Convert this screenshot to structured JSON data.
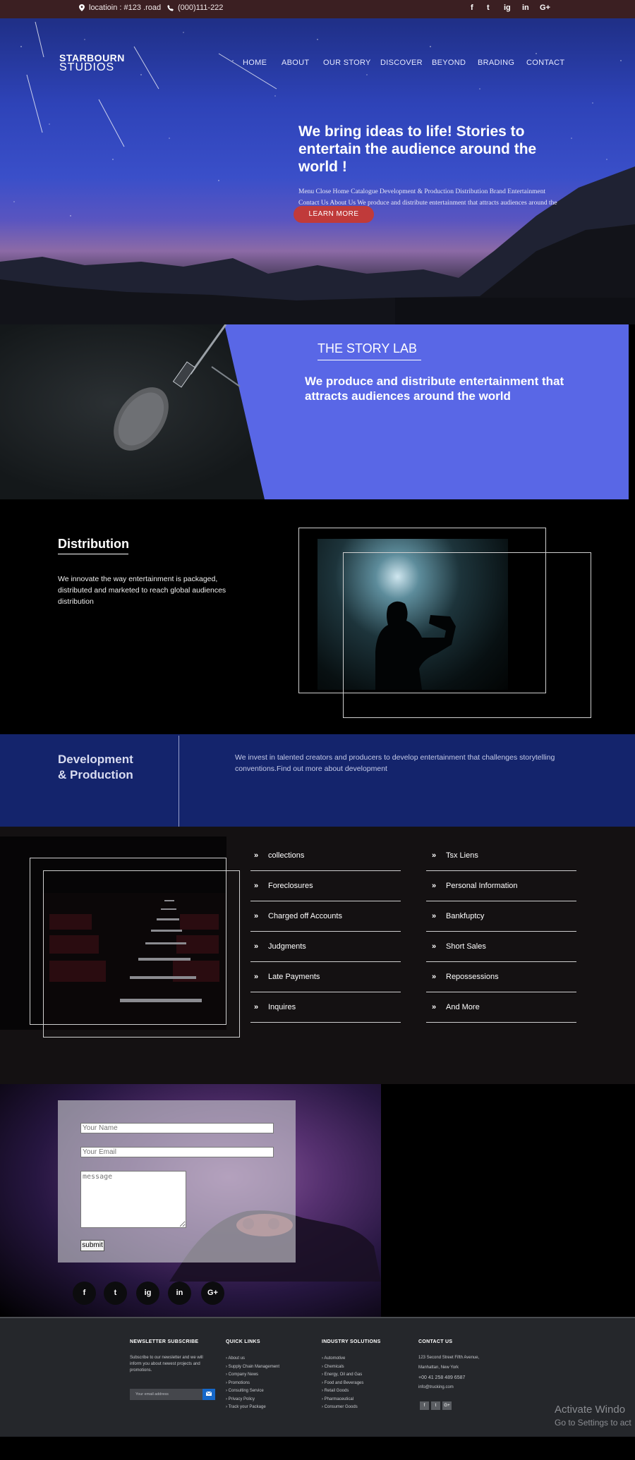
{
  "topbar": {
    "location": "locatioin : #123 .road",
    "phone": "(000)111-222",
    "social": [
      "f",
      "t",
      "ig",
      "in",
      "G+"
    ]
  },
  "brand": {
    "line1": "STARBOURN",
    "line2": "STUDIOS"
  },
  "nav": [
    "HOME",
    "ABOUT",
    "OUR STORY",
    "DISCOVER",
    "BEYOND",
    "BRADING",
    "CONTACT"
  ],
  "hero": {
    "headline": "We bring ideas to life! Stories to entertain the audience around the world !",
    "subtext": "Menu Close Home Catalogue Development & Production Distribution Brand Entertainment Contact Us About Us We produce and distribute entertainment that attracts audiences around the world",
    "cta": "LEARN MORE"
  },
  "story_lab": {
    "title": "THE STORY LAB",
    "text": "We produce and distribute entertainment that attracts audiences around the world"
  },
  "distribution": {
    "title": "Distribution",
    "text": "We innovate the way entertainment is packaged, distributed and marketed to reach global audiences distribution"
  },
  "development": {
    "title_line1": "Development",
    "title_line2": "& Production",
    "text": "We invest in talented creators and producers to develop entertainment that challenges storytelling conventions.Find out more about development"
  },
  "services": {
    "left": [
      "collections",
      "Foreclosures",
      "Charged off Accounts",
      "Judgments",
      "Late Payments",
      "Inquires"
    ],
    "right": [
      "Tsx Liens",
      "Personal Information",
      "Bankfuptcy",
      "Short Sales",
      "Repossessions",
      "And More"
    ]
  },
  "contact_form": {
    "name_placeholder": "Your Name",
    "email_placeholder": "Your Email",
    "message_placeholder": "message",
    "submit": "submit"
  },
  "contact_social": [
    "f",
    "t",
    "ig",
    "in",
    "G+"
  ],
  "footer": {
    "newsletter": {
      "title": "NEWSLETTER SUBSCRIBE",
      "text": "Subscribe to our newsletter and we will inform you about newest projects and promotions.",
      "input_placeholder": "Your email address"
    },
    "quick_links": {
      "title": "QUICK LINKS",
      "items": [
        "About us",
        "Supply Chain Management",
        "Company News",
        "Promotions",
        "Consulting Service",
        "Privacy Policy",
        "Track your Package"
      ]
    },
    "industry": {
      "title": "INDUSTRY SOLUTIONS",
      "items": [
        "Automotive",
        "Chemicals",
        "Energy, Oil and Gas",
        "Food and Beverages",
        "Retail Goods",
        "Pharmaceutical",
        "Consumer Goods"
      ]
    },
    "contact": {
      "title": "CONTACT US",
      "address1": "123 Second Street Fifth Avenue,",
      "address2": "Manhattan, New York",
      "phone": "+00 41 258 489 6587",
      "email": "info@trucking.com",
      "social": [
        "f",
        "t",
        "G+"
      ]
    }
  },
  "watermark": {
    "line1": "Activate Windo",
    "line2": "Go to Settings to act"
  },
  "colors": {
    "topbar": "#3b1f22",
    "story_lab_panel": "#5967e6",
    "development_bg": "#14246c",
    "cta": "#c03a3a",
    "list_bg": "#141112",
    "footer_bg": "#25272b"
  }
}
